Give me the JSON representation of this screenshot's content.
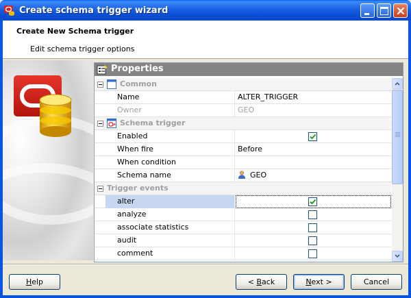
{
  "window": {
    "title": "Create schema trigger wizard"
  },
  "header": {
    "title": "Create New Schema trigger",
    "subtitle": "Edit schema trigger options"
  },
  "properties": {
    "title": "Properties",
    "categories": {
      "common": "Common",
      "schema_trigger": "Schema trigger",
      "trigger_events": "Trigger events"
    },
    "rows": {
      "name": {
        "label": "Name",
        "value": "ALTER_TRIGGER"
      },
      "owner": {
        "label": "Owner",
        "value": "GEO"
      },
      "enabled": {
        "label": "Enabled",
        "checked": true
      },
      "when_fire": {
        "label": "When fire",
        "value": "Before"
      },
      "when_condition": {
        "label": "When condition",
        "value": ""
      },
      "schema_name": {
        "label": "Schema name",
        "value": "GEO"
      },
      "alter": {
        "label": "alter",
        "checked": true
      },
      "analyze": {
        "label": "analyze",
        "checked": false
      },
      "associate_statistics": {
        "label": "associate statistics",
        "checked": false
      },
      "audit": {
        "label": "audit",
        "checked": false
      },
      "comment": {
        "label": "comment",
        "checked": false
      }
    }
  },
  "buttons": {
    "help": {
      "pre": "",
      "u": "H",
      "post": "elp"
    },
    "back": {
      "pre": "< ",
      "u": "B",
      "post": "ack"
    },
    "next": {
      "pre": "",
      "u": "N",
      "post": "ext >"
    },
    "cancel": {
      "pre": "Cancel",
      "u": "",
      "post": ""
    }
  },
  "colors": {
    "titlebar": "#0a54e4",
    "selection": "#c6d7ef",
    "properties_header": "#848484",
    "check_mark": "#21a121"
  }
}
